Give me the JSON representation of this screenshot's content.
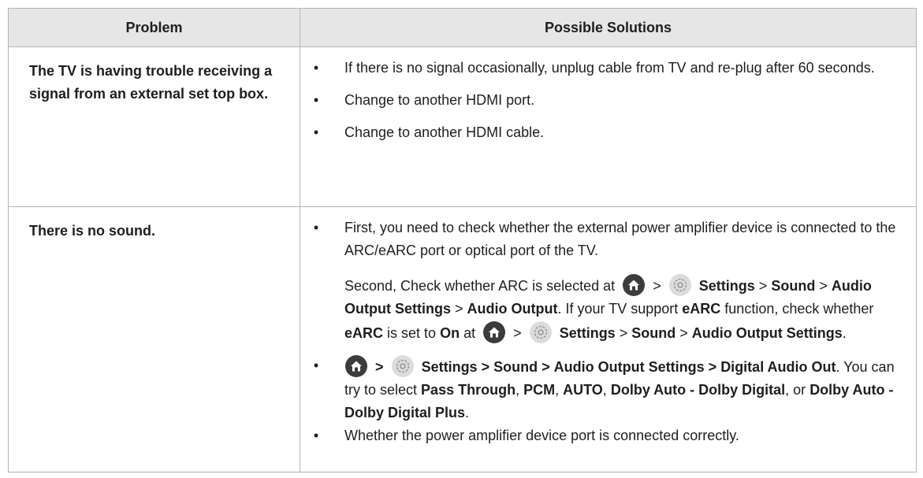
{
  "headers": {
    "problem": "Problem",
    "solutions": "Possible Solutions"
  },
  "rows": [
    {
      "problem": "The TV is having trouble receiving a signal from an external set top box.",
      "solutions": [
        "If there is no signal occasionally, unplug cable from TV and re-plug after 60 seconds.",
        "Change to another HDMI port.",
        "Change to another HDMI cable."
      ]
    },
    {
      "problem": "There is no sound.",
      "solution1": "First, you need to check whether the external power amplifier device is connected to the ARC/eARC port or optical port of the TV.",
      "para": {
        "t1": "Second, Check whether ARC is selected at",
        "gt": ">",
        "settings": "Settings",
        "sound": "Sound",
        "audio_output_settings": "Audio Output Settings",
        "audio_output": "Audio Output",
        "t2": ". If your TV support",
        "earc": "eARC",
        "t3": "function, check whether",
        "t4": "is set to",
        "on": "On",
        "t5": "at",
        "end": "."
      },
      "solution3": {
        "digital_audio_out": "Digital Audio Out",
        "t1": ". You can try to select",
        "pass_through": "Pass Through",
        "comma": ",",
        "pcm": "PCM",
        "auto": "AUTO",
        "dolby_auto_dd": "Dolby Auto - Dolby Digital",
        "or": ", or",
        "dolby_auto_ddp": "Dolby Auto - Dolby Digital Plus",
        "end": "."
      },
      "solution4": "Whether the power amplifier device port is connected correctly."
    }
  ],
  "icons": {
    "home": "home-icon",
    "settings": "gear-icon"
  },
  "colors": {
    "header_bg": "#e6e6e6",
    "border": "#b4b4b4",
    "home_icon": "#3c3c3c",
    "gear_icon": "#dcdcdc"
  }
}
